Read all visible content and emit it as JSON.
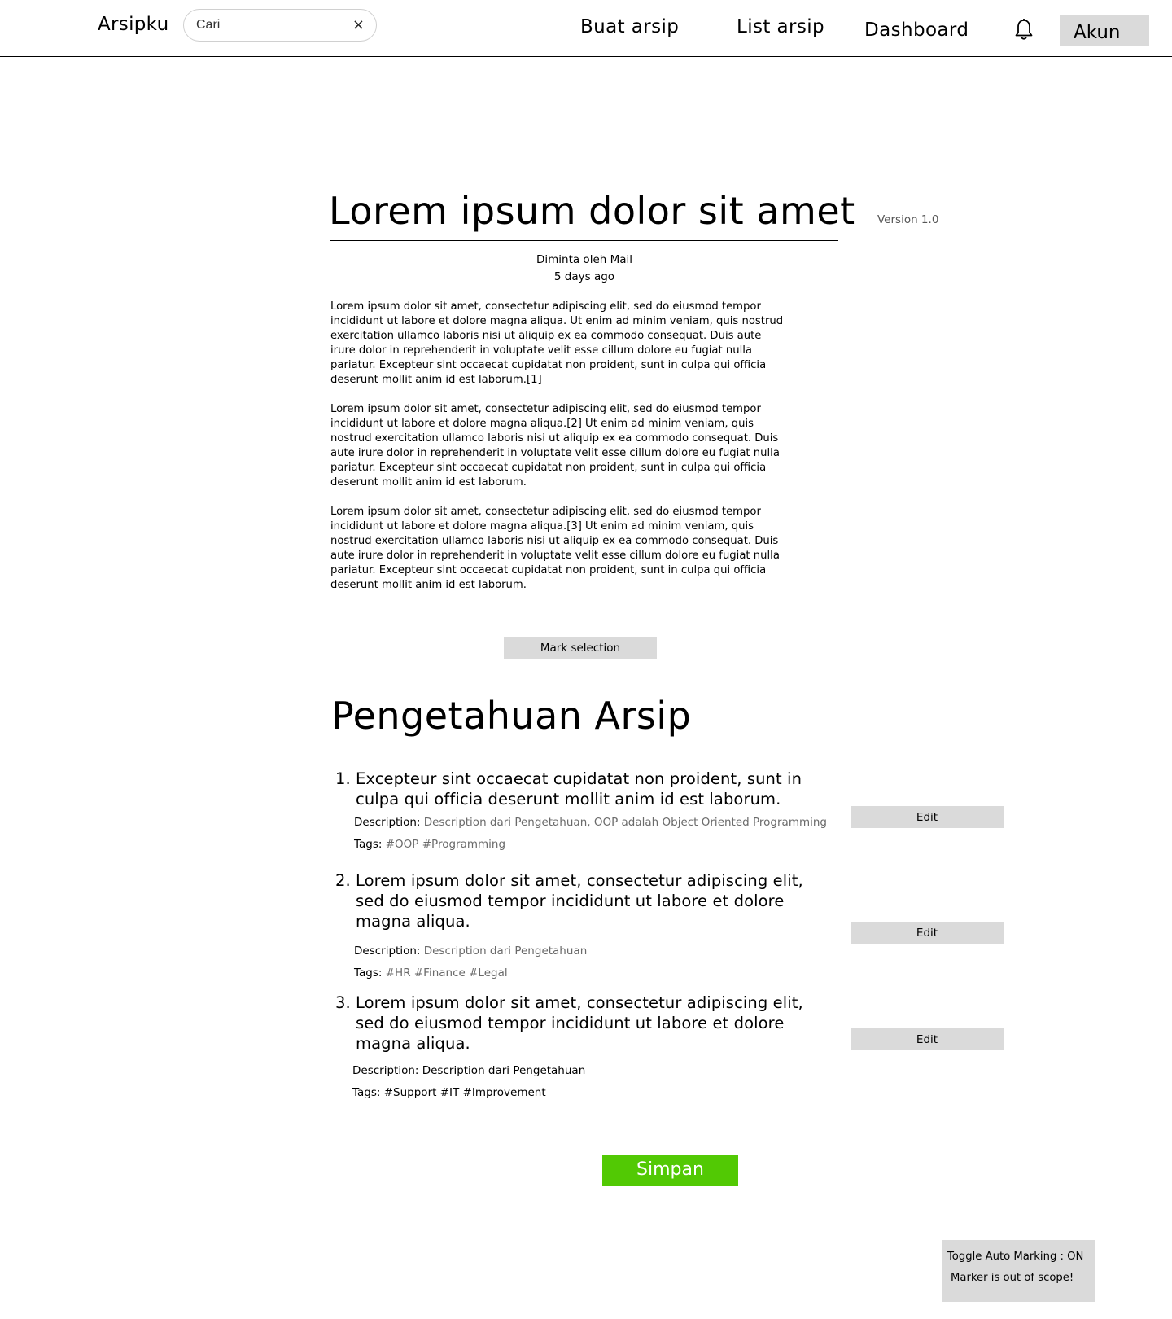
{
  "header": {
    "brand": "Arsipku",
    "search_placeholder": "Cari",
    "clear_symbol": "×",
    "nav": {
      "create": "Buat arsip",
      "list": "List arsip",
      "dashboard": "Dashboard"
    },
    "notification_icon": "bell-icon",
    "account": "Akun"
  },
  "document": {
    "title": "Lorem ipsum dolor sit amet",
    "version": "Version 1.0",
    "requested_by": "Diminta oleh Mail",
    "time_ago": "5 days ago",
    "paragraphs": [
      "Lorem ipsum dolor sit amet, consectetur adipiscing elit, sed do eiusmod tempor incididunt ut labore et dolore magna aliqua. Ut enim ad minim veniam, quis nostrud exercitation ullamco laboris nisi ut aliquip ex ea commodo consequat. Duis aute irure dolor in reprehenderit in voluptate velit esse cillum dolore eu fugiat nulla pariatur. Excepteur sint occaecat cupidatat non proident, sunt in culpa qui officia deserunt mollit anim id est laborum.[1]",
      "Lorem ipsum dolor sit amet, consectetur adipiscing elit, sed do eiusmod tempor incididunt ut labore et dolore magna aliqua.[2] Ut enim ad minim veniam, quis nostrud exercitation ullamco laboris nisi ut aliquip ex ea commodo consequat. Duis aute irure dolor in reprehenderit in voluptate velit esse cillum dolore eu fugiat nulla pariatur. Excepteur sint occaecat cupidatat non proident, sunt in culpa qui officia deserunt mollit anim id est laborum.",
      "Lorem ipsum dolor sit amet, consectetur adipiscing elit, sed do eiusmod tempor incididunt ut labore et dolore magna aliqua.[3] Ut enim ad minim veniam, quis nostrud exercitation ullamco laboris nisi ut aliquip ex ea commodo consequat. Duis aute irure dolor in reprehenderit in voluptate velit esse cillum dolore eu fugiat nulla pariatur. Excepteur sint occaecat cupidatat non proident, sunt in culpa qui officia deserunt mollit anim id est laborum."
    ],
    "mark_selection": "Mark selection"
  },
  "knowledge": {
    "heading": "Pengetahuan Arsip",
    "description_label": "Description:",
    "tags_label": "Tags:",
    "edit_label": "Edit",
    "items": [
      {
        "number": "1.",
        "text": "Excepteur sint occaecat cupidatat non proident, sunt in culpa qui officia deserunt mollit anim id est laborum.",
        "description": "Description dari Pengetahuan, OOP adalah Object Oriented Programming",
        "tags": "#OOP #Programming"
      },
      {
        "number": "2.",
        "text": "Lorem ipsum dolor sit amet, consectetur adipiscing elit, sed do eiusmod tempor incididunt ut labore et dolore magna aliqua.",
        "description": "Description dari Pengetahuan",
        "tags": "#HR #Finance #Legal"
      },
      {
        "number": "3.",
        "text": "Lorem ipsum dolor sit amet, consectetur adipiscing elit, sed do eiusmod tempor incididunt ut labore et dolore magna aliqua.",
        "description": "Description dari Pengetahuan",
        "tags": "#Support #IT #Improvement"
      }
    ]
  },
  "actions": {
    "save": "Simpan",
    "save_color": "#52c904"
  },
  "status_panel": {
    "toggle_auto_marking": "Toggle Auto Marking : ON",
    "marker_message": "Marker is out of scope!"
  }
}
